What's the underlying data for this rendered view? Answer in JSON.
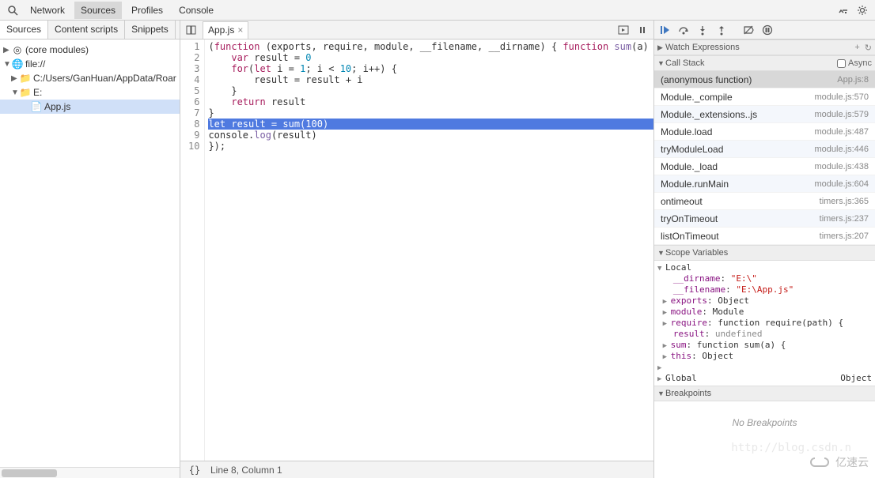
{
  "top_tabs": [
    "Network",
    "Sources",
    "Profiles",
    "Console"
  ],
  "top_tabs_active": 1,
  "left_tabs": [
    "Sources",
    "Content scripts",
    "Snippets"
  ],
  "left_tabs_active": 0,
  "file_tree": {
    "core_modules": "(core modules)",
    "file_scheme": "file://",
    "path_c": "C:/Users/GanHuan/AppData/Roar",
    "path_e": "E:",
    "app_js": "App.js"
  },
  "open_file_tab": "App.js",
  "code_lines": [
    {
      "raw": "(function (exports, require, module, __filename, __dirname) { function sum(a) {"
    },
    {
      "raw": "    var result = 0"
    },
    {
      "raw": "    for(let i = 1; i < 10; i++) {"
    },
    {
      "raw": "        result = result + i"
    },
    {
      "raw": "    }"
    },
    {
      "raw": "    return result"
    },
    {
      "raw": "}"
    },
    {
      "raw": "let result = sum(100)",
      "highlight": true
    },
    {
      "raw": "console.log(result)"
    },
    {
      "raw": "});"
    }
  ],
  "status": {
    "cursor": "Line 8, Column 1"
  },
  "debug_sections": {
    "watch": "Watch Expressions",
    "callstack": "Call Stack",
    "async": "Async",
    "scope": "Scope Variables",
    "breakpoints": "Breakpoints",
    "no_breakpoints": "No Breakpoints"
  },
  "callstack": [
    {
      "name": "(anonymous function)",
      "loc": "App.js:8",
      "sel": true
    },
    {
      "name": "Module._compile",
      "loc": "module.js:570"
    },
    {
      "name": "Module._extensions..js",
      "loc": "module.js:579"
    },
    {
      "name": "Module.load",
      "loc": "module.js:487"
    },
    {
      "name": "tryModuleLoad",
      "loc": "module.js:446"
    },
    {
      "name": "Module._load",
      "loc": "module.js:438"
    },
    {
      "name": "Module.runMain",
      "loc": "module.js:604"
    },
    {
      "name": "ontimeout",
      "loc": "timers.js:365"
    },
    {
      "name": "tryOnTimeout",
      "loc": "timers.js:237"
    },
    {
      "name": "listOnTimeout",
      "loc": "timers.js:207"
    }
  ],
  "scope": {
    "local_label": "Local",
    "dirname": {
      "k": "__dirname",
      "v": "\"E:\\\""
    },
    "filename": {
      "k": "__filename",
      "v": "\"E:\\App.js\""
    },
    "exports": {
      "k": "exports",
      "v": "Object"
    },
    "module": {
      "k": "module",
      "v": "Module"
    },
    "require": {
      "k": "require",
      "v": "function require(path) {"
    },
    "result": {
      "k": "result",
      "v": "undefined"
    },
    "sum": {
      "k": "sum",
      "v": "function sum(a) {"
    },
    "this": {
      "k": "this",
      "v": "Object"
    },
    "global_label": "Global",
    "global_val": "Object"
  },
  "watermark": "http://blog.csdn.n",
  "watermark2": "亿速云"
}
